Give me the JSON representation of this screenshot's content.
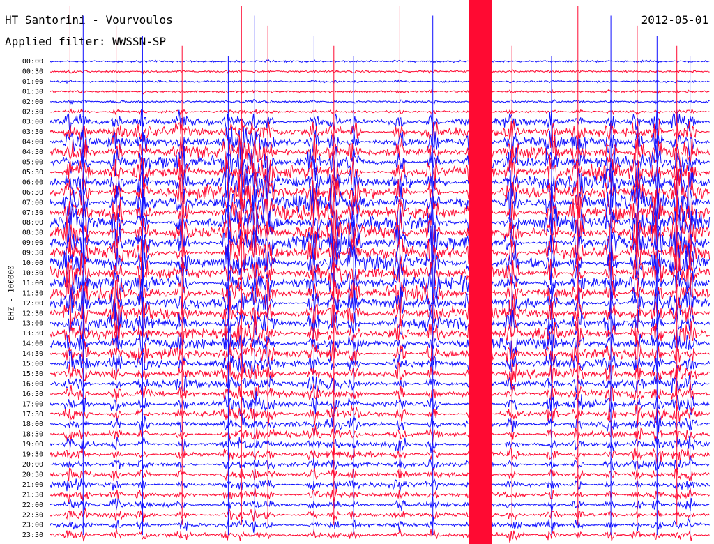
{
  "header": {
    "title": "HT Santorini - Vourvoulos",
    "date": "2012-05-01",
    "filter": "Applied filter: WWSSN-SP"
  },
  "channel_label": "EHZ - 100000",
  "colors": {
    "trace_a": "#1010ff",
    "trace_b": "#ff0a32",
    "background": "#ffffff",
    "text": "#000000"
  },
  "chart_data": {
    "type": "line",
    "title": "HT Santorini - Vourvoulos",
    "subtitle": "Applied filter: WWSSN-SP",
    "ylabel": "EHZ - 100000",
    "xlabel": "",
    "grid": false,
    "trace_colors": [
      "#1010ff",
      "#ff0a32"
    ],
    "rows": [
      "00:00",
      "00:30",
      "01:00",
      "01:30",
      "02:00",
      "02:30",
      "03:00",
      "03:30",
      "04:00",
      "04:30",
      "05:00",
      "05:30",
      "06:00",
      "06:30",
      "07:00",
      "07:30",
      "08:00",
      "08:30",
      "09:00",
      "09:30",
      "10:00",
      "10:30",
      "11:00",
      "11:30",
      "12:00",
      "12:30",
      "13:00",
      "13:30",
      "14:00",
      "14:30",
      "15:00",
      "15:30",
      "16:00",
      "16:30",
      "17:00",
      "17:30",
      "18:00",
      "18:30",
      "19:00",
      "19:30",
      "20:00",
      "20:30",
      "21:00",
      "21:30",
      "22:00",
      "22:30",
      "23:00",
      "23:30"
    ],
    "relative_amplitude": [
      0.15,
      0.2,
      0.2,
      0.25,
      0.3,
      0.35,
      1.4,
      1.8,
      2.0,
      2.2,
      2.4,
      2.5,
      2.6,
      2.7,
      2.8,
      2.8,
      2.9,
      2.9,
      2.8,
      2.7,
      2.6,
      2.5,
      2.5,
      2.4,
      2.3,
      2.2,
      2.1,
      2.0,
      1.9,
      1.8,
      1.6,
      1.5,
      1.4,
      1.3,
      1.25,
      1.2,
      1.1,
      1.05,
      1.0,
      1.0,
      0.95,
      0.9,
      0.9,
      0.85,
      0.85,
      0.8,
      0.8,
      0.8
    ],
    "event_x": [
      0.03,
      0.05,
      0.1,
      0.14,
      0.2,
      0.27,
      0.29,
      0.31,
      0.33,
      0.4,
      0.43,
      0.46,
      0.53,
      0.58,
      0.64,
      0.66,
      0.7,
      0.76,
      0.8,
      0.85,
      0.89,
      0.92,
      0.95,
      0.97
    ]
  }
}
